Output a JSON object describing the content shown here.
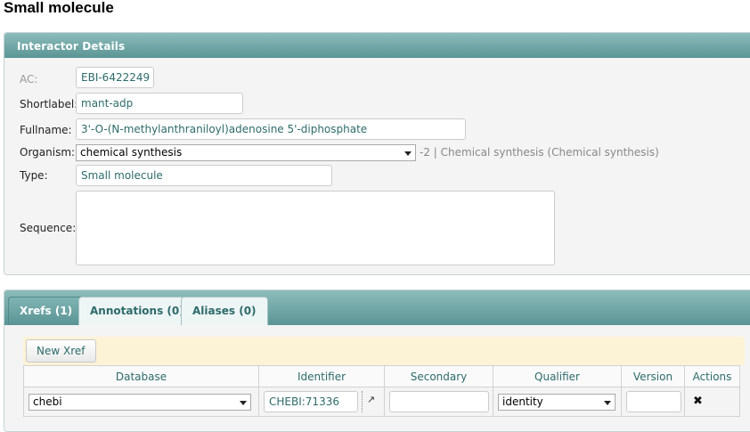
{
  "page": {
    "title": "Small molecule"
  },
  "details": {
    "header": "Interactor Details",
    "ac_label": "AC:",
    "ac_value": "EBI-6422249",
    "shortlabel_label": "Shortlabel:",
    "shortlabel_value": "mant-adp",
    "fullname_label": "Fullname:",
    "fullname_value": "3'-O-(N-methylanthraniloyl)adenosine 5'-diphosphate",
    "organism_label": "Organism:",
    "organism_value": "chemical synthesis",
    "organism_extra": "-2 | Chemical synthesis (Chemical synthesis)",
    "type_label": "Type:",
    "type_value": "Small molecule",
    "sequence_label": "Sequence:",
    "sequence_value": ""
  },
  "tabs": [
    {
      "label": "Xrefs (1)",
      "active": true
    },
    {
      "label": "Annotations (0)",
      "active": false
    },
    {
      "label": "Aliases (0)",
      "active": false
    }
  ],
  "xrefs": {
    "new_button": "New Xref",
    "columns": [
      "Database",
      "Identifier",
      "Secondary",
      "Qualifier",
      "Version",
      "Actions"
    ],
    "rows": [
      {
        "database": "chebi",
        "identifier": "CHEBI:71336",
        "secondary": "",
        "qualifier": "identity",
        "version": ""
      }
    ]
  },
  "icons": {
    "external_link": "external-link-icon",
    "delete": "delete-icon",
    "dropdown": "chevron-down-icon"
  },
  "colors": {
    "header_teal": "#5b9595",
    "text_teal": "#2e6b6b",
    "toolbar_cream": "#fcf3d6"
  }
}
